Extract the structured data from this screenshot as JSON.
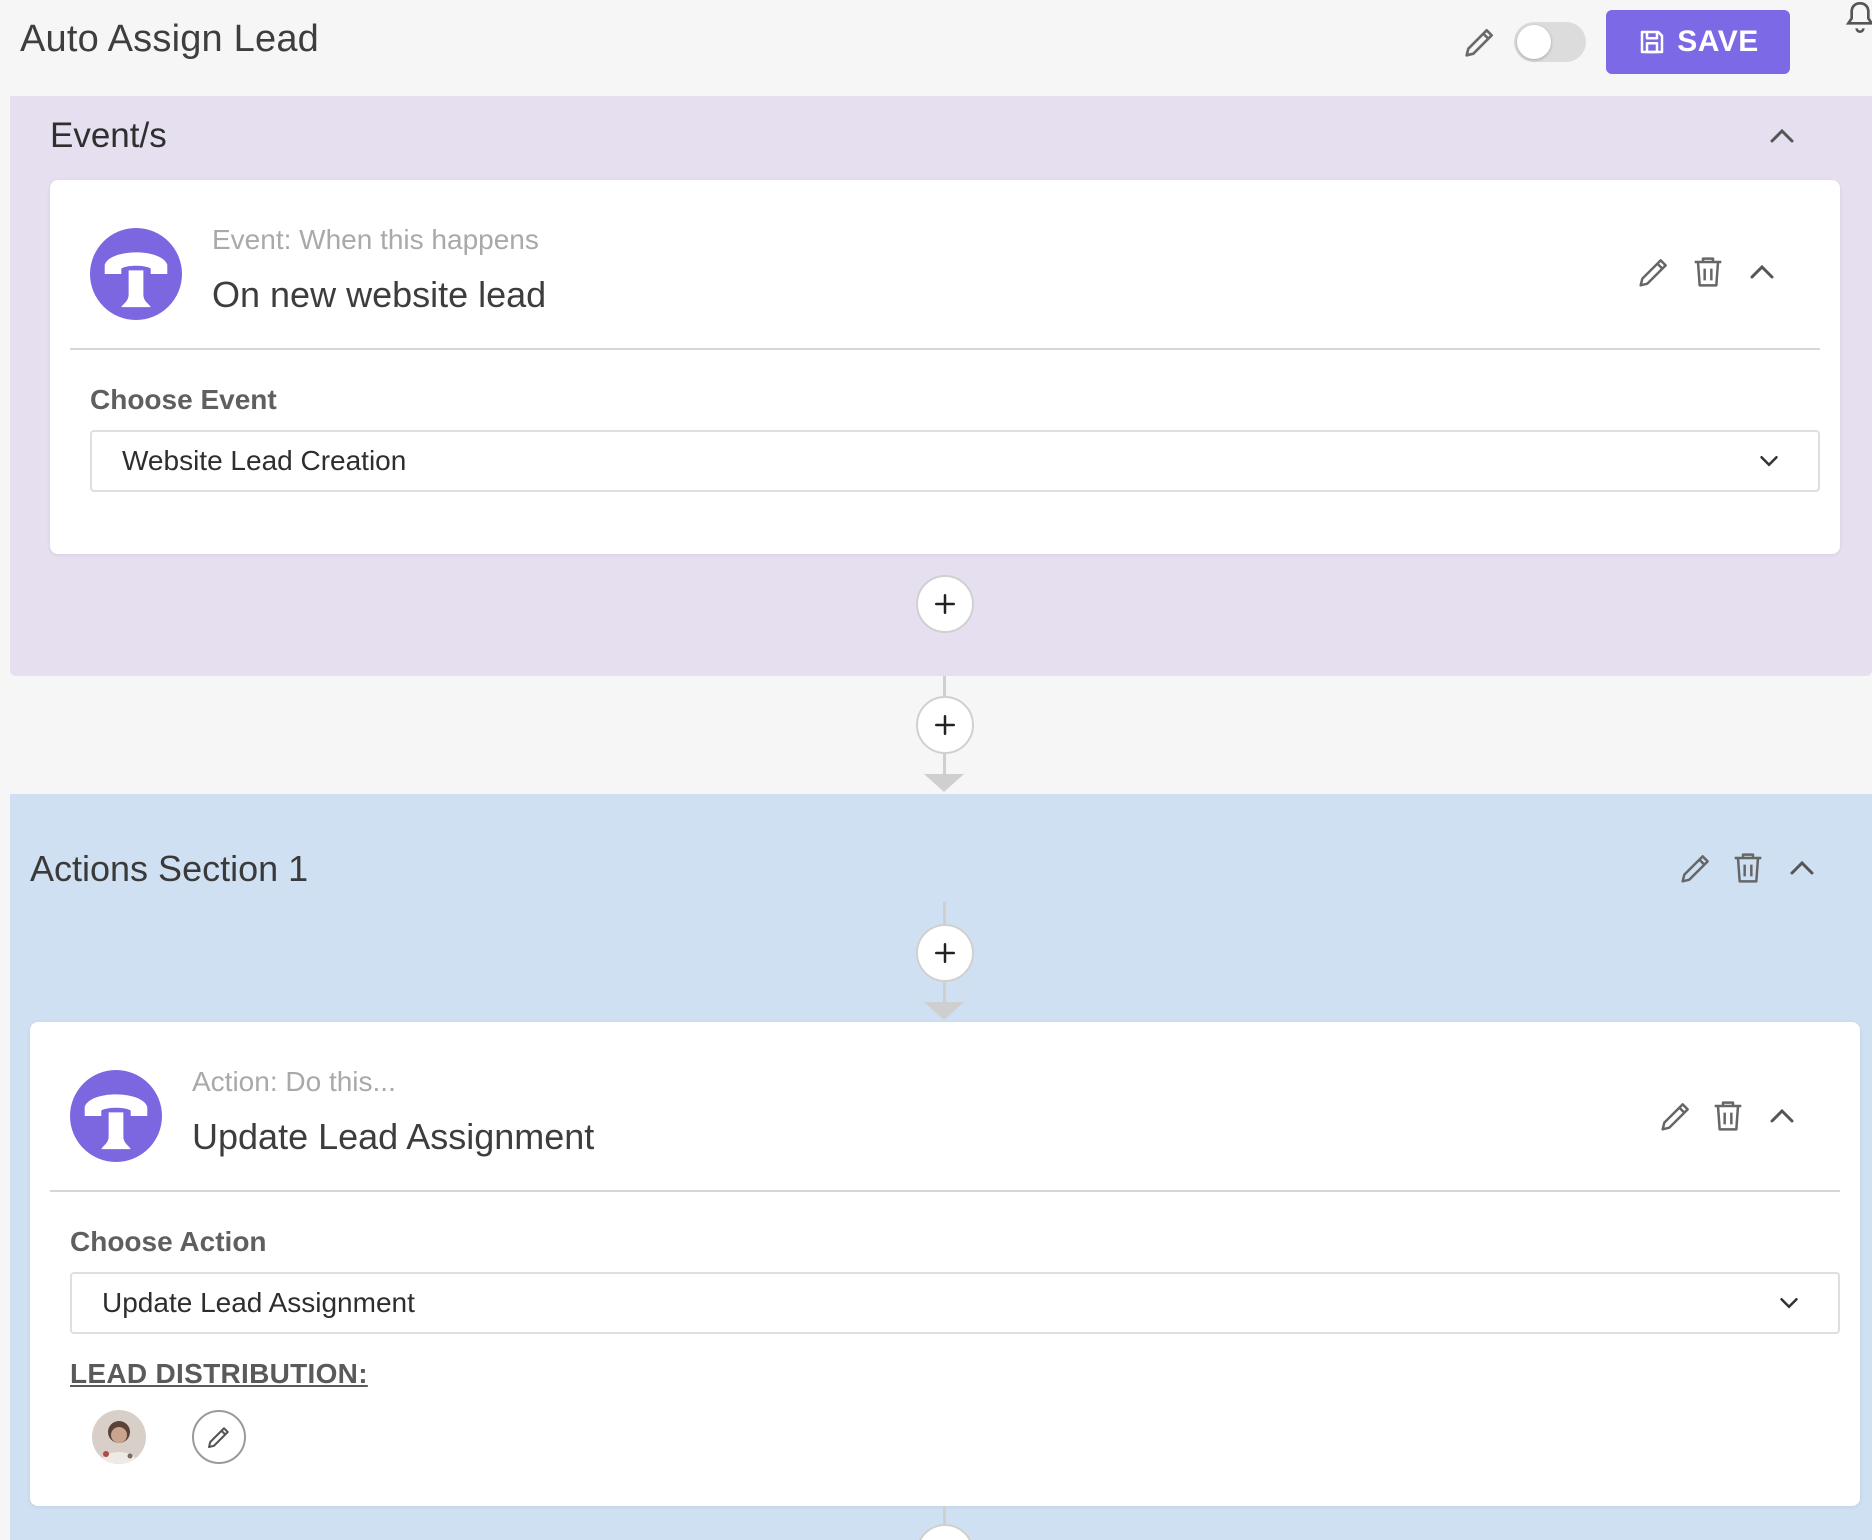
{
  "header": {
    "title": "Auto Assign Lead",
    "save_label": "SAVE",
    "accent_color": "#7c69e6"
  },
  "events": {
    "section_title": "Event/s",
    "section_color": "#e6dff0",
    "card": {
      "icon": "phone-t-icon",
      "subtitle": "Event: When this happens",
      "title": "On new website lead",
      "field_label": "Choose Event",
      "selected_value": "Website Lead Creation"
    }
  },
  "actions": {
    "section_title": "Actions Section 1",
    "section_color": "#cfe0f3",
    "card": {
      "icon": "phone-t-icon",
      "subtitle": "Action: Do this...",
      "title": "Update Lead Assignment",
      "field_label": "Choose Action",
      "selected_value": "Update Lead Assignment",
      "distribution_label": "LEAD DISTRIBUTION:"
    }
  }
}
